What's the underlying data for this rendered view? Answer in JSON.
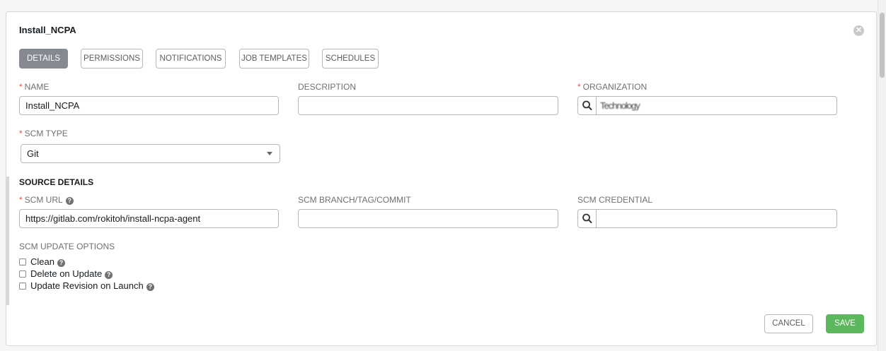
{
  "form": {
    "title": "Install_NCPA",
    "close_glyph": "✕"
  },
  "tabs": [
    {
      "label": "DETAILS",
      "active": true
    },
    {
      "label": "PERMISSIONS",
      "active": false
    },
    {
      "label": "NOTIFICATIONS",
      "active": false
    },
    {
      "label": "JOB TEMPLATES",
      "active": false
    },
    {
      "label": "SCHEDULES",
      "active": false
    }
  ],
  "fields": {
    "name": {
      "label": "NAME",
      "required": "*",
      "value": "Install_NCPA"
    },
    "description": {
      "label": "DESCRIPTION",
      "value": ""
    },
    "organization": {
      "label": "ORGANIZATION",
      "required": "*",
      "value": "Technology"
    },
    "scm_type": {
      "label": "SCM TYPE",
      "required": "*",
      "value": "Git"
    }
  },
  "source_details": {
    "title": "SOURCE DETAILS",
    "scm_url": {
      "label": "SCM URL",
      "required": "*",
      "value": "https://gitlab.com/rokitoh/install-ncpa-agent"
    },
    "scm_branch": {
      "label": "SCM BRANCH/TAG/COMMIT",
      "value": ""
    },
    "scm_credential": {
      "label": "SCM CREDENTIAL",
      "value": ""
    },
    "update_options": {
      "label": "SCM UPDATE OPTIONS",
      "items": [
        {
          "label": "Clean",
          "checked": false
        },
        {
          "label": "Delete on Update",
          "checked": false
        },
        {
          "label": "Update Revision on Launch",
          "checked": false
        }
      ]
    }
  },
  "actions": {
    "cancel_label": "CANCEL",
    "save_label": "SAVE"
  },
  "colors": {
    "accent_green": "#5cb85c",
    "required_red": "#d9534f",
    "active_tab": "#848992"
  },
  "icons": {
    "help": "?",
    "search": "search-icon"
  }
}
